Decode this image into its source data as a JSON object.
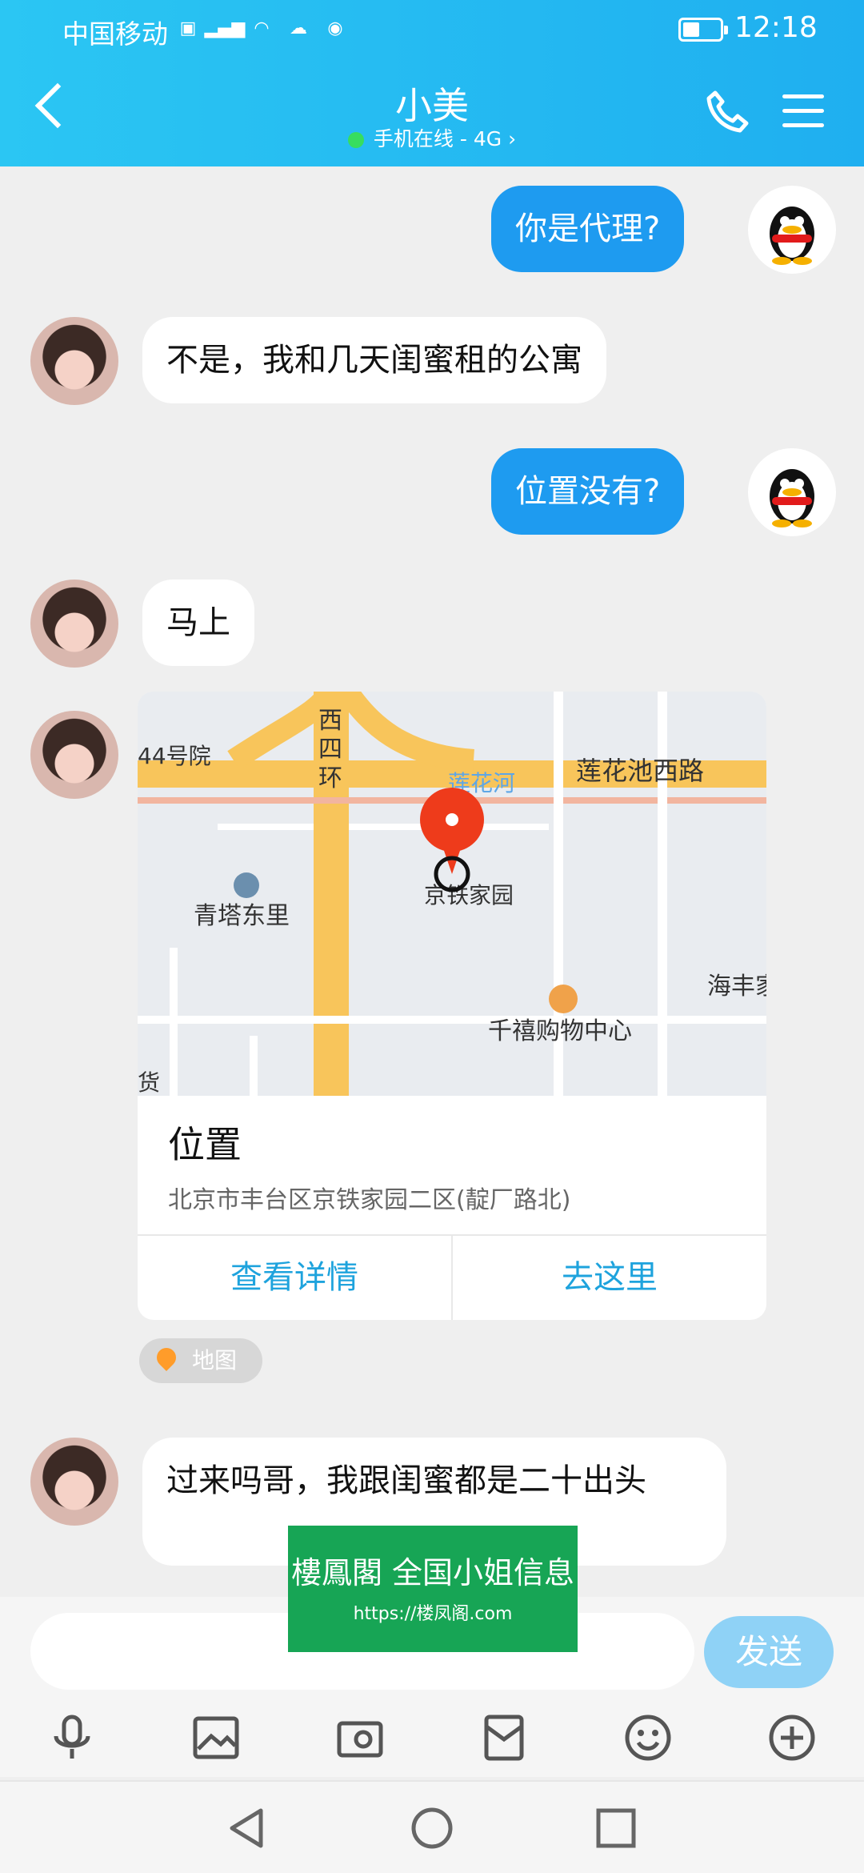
{
  "status_bar": {
    "carrier": "中国移动",
    "time": "12:18"
  },
  "header": {
    "title": "小美",
    "subtitle": "手机在线 - 4G"
  },
  "messages": [
    {
      "side": "right",
      "text": "你是代理?"
    },
    {
      "side": "left",
      "text": "不是，我和几天闺蜜租的公寓"
    },
    {
      "side": "right",
      "text": "位置没有?"
    },
    {
      "side": "left",
      "text": "马上"
    },
    {
      "side": "left",
      "text": "过来吗哥，我跟闺蜜都是二十出头"
    }
  ],
  "location_card": {
    "map_labels": {
      "road1": "西四环",
      "road2": "莲花池西路",
      "river": "莲花河",
      "place1": "44号院",
      "place2": "京铁家园",
      "place3": "青塔东里",
      "place4": "海丰家",
      "place5": "千禧购物中心",
      "place6": "货"
    },
    "title": "位置",
    "address": "北京市丰台区京铁家园二区(靛厂路北)",
    "detail_button": "查看详情",
    "go_button": "去这里",
    "source_tag": "地图"
  },
  "watermark": {
    "line1": "樓鳳閣 全国小姐信息",
    "line2": "https://楼凤阁.com"
  },
  "input_bar": {
    "placeholder": "",
    "send_label": "发送"
  },
  "colors": {
    "header": "#22bcf2",
    "my_bubble": "#1e9bf0",
    "link": "#1ea3dd"
  }
}
